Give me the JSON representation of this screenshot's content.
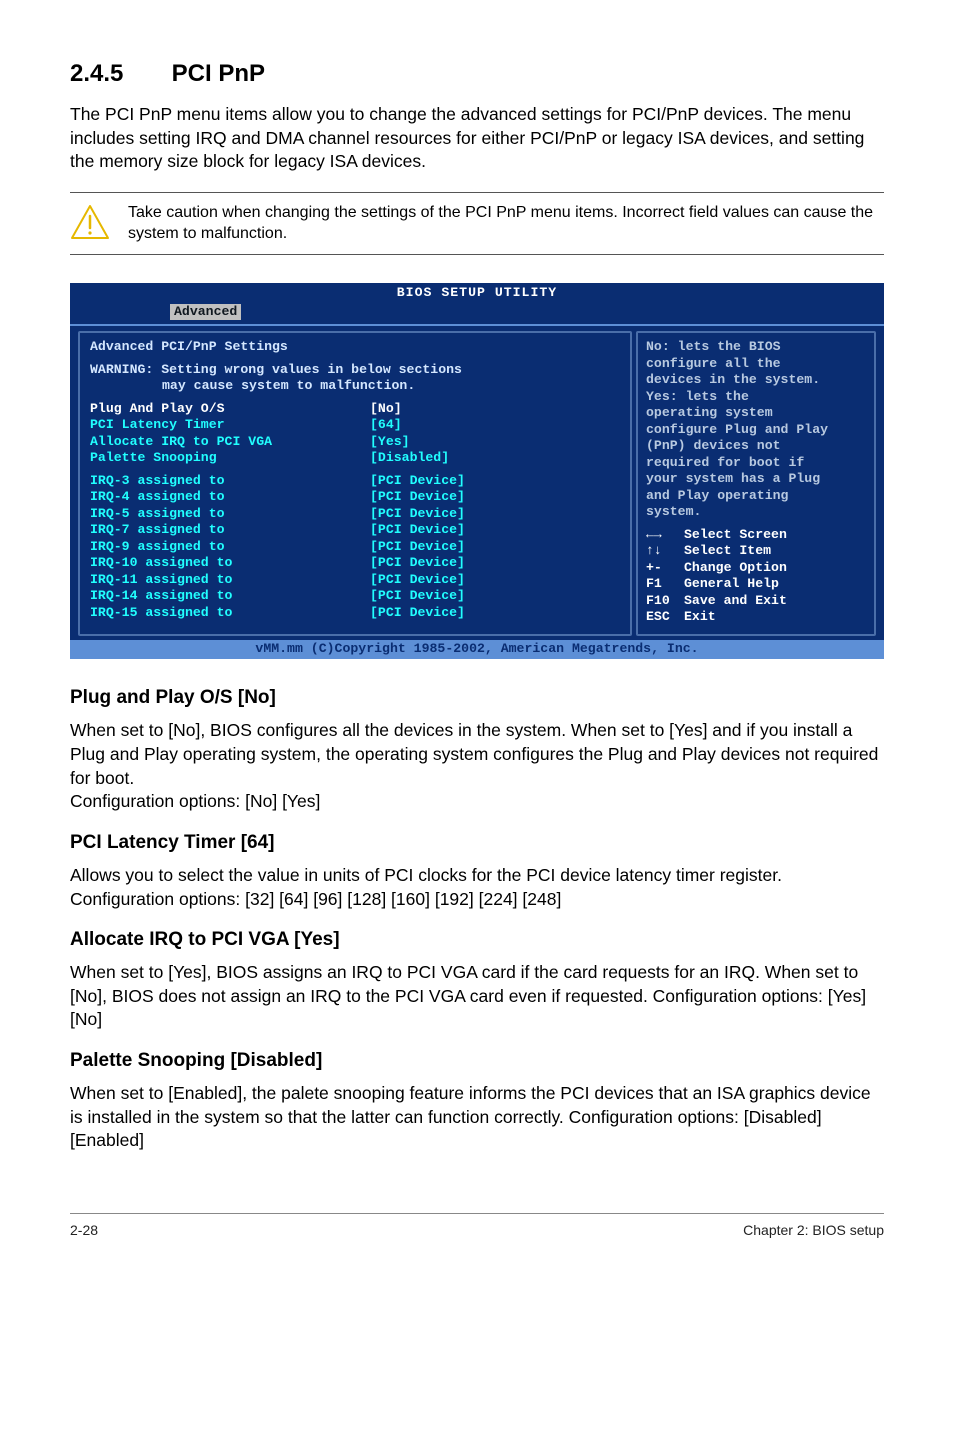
{
  "heading": {
    "number": "2.4.5",
    "title": "PCI PnP"
  },
  "intro": "The PCI PnP menu items allow you to change the advanced settings for PCI/PnP devices. The menu includes setting IRQ and DMA channel resources for either PCI/PnP or legacy ISA devices, and setting the memory size block for legacy ISA devices.",
  "caution": "Take caution when changing the settings of the PCI PnP menu items. Incorrect field values can cause the system to malfunction.",
  "bios": {
    "title": "BIOS SETUP UTILITY",
    "tab": "Advanced",
    "leftTitle": "Advanced PCI/PnP Settings",
    "warningLabel": "WARNING:",
    "warning1": "Setting wrong values in below sections",
    "warning2": "may cause system to malfunction.",
    "rows": [
      {
        "label": "Plug And Play O/S",
        "value": "[No]",
        "hilite": true
      },
      {
        "label": "PCI Latency Timer",
        "value": "[64]"
      },
      {
        "label": "Allocate IRQ to PCI VGA",
        "value": "[Yes]"
      },
      {
        "label": "Palette Snooping",
        "value": "[Disabled]"
      }
    ],
    "irqRows": [
      {
        "label": "IRQ-3 assigned to",
        "value": "[PCI Device]"
      },
      {
        "label": "IRQ-4 assigned to",
        "value": "[PCI Device]"
      },
      {
        "label": "IRQ-5 assigned to",
        "value": "[PCI Device]"
      },
      {
        "label": "IRQ-7 assigned to",
        "value": "[PCI Device]"
      },
      {
        "label": "IRQ-9 assigned to",
        "value": "[PCI Device]"
      },
      {
        "label": "IRQ-10 assigned to",
        "value": "[PCI Device]"
      },
      {
        "label": "IRQ-11 assigned to",
        "value": "[PCI Device]"
      },
      {
        "label": "IRQ-14 assigned to",
        "value": "[PCI Device]"
      },
      {
        "label": "IRQ-15 assigned to",
        "value": "[PCI Device]"
      }
    ],
    "help": [
      "No: lets the BIOS",
      "configure all the",
      "devices in the system.",
      "Yes: lets the",
      "operating system",
      "configure Plug and Play",
      "(PnP) devices not",
      "required for boot if",
      "your system has a Plug",
      "and Play operating",
      "system."
    ],
    "keys": [
      {
        "k": "←→",
        "d": "Select Screen"
      },
      {
        "k": "↑↓",
        "d": "Select Item"
      },
      {
        "k": "+-",
        "d": "Change Option"
      },
      {
        "k": "F1",
        "d": "General Help"
      },
      {
        "k": "F10",
        "d": "Save and Exit"
      },
      {
        "k": "ESC",
        "d": "Exit"
      }
    ],
    "footer": "vMM.mm (C)Copyright 1985-2002, American Megatrends, Inc."
  },
  "subsections": [
    {
      "title": "Plug and Play O/S [No]",
      "text": "When set to [No], BIOS configures all the devices in the system. When set to [Yes] and if you install a Plug and Play operating system, the operating system configures the Plug and Play devices not required for boot.\nConfiguration options: [No] [Yes]"
    },
    {
      "title": "PCI Latency Timer [64]",
      "text": "Allows you to select the value in units of PCI clocks for the PCI device latency timer register. Configuration options: [32] [64] [96] [128] [160] [192] [224] [248]"
    },
    {
      "title": "Allocate IRQ to PCI VGA [Yes]",
      "text": "When set to [Yes], BIOS assigns an IRQ to PCI VGA card if the card requests for an IRQ. When set to [No], BIOS does not assign an IRQ to the PCI VGA card even if requested. Configuration options: [Yes] [No]"
    },
    {
      "title": "Palette Snooping [Disabled]",
      "text": "When set to [Enabled], the palete snooping feature informs the PCI devices that an ISA graphics device is installed in the system so that the latter can function correctly. Configuration options: [Disabled] [Enabled]"
    }
  ],
  "footer": {
    "left": "2-28",
    "right": "Chapter 2: BIOS setup"
  }
}
